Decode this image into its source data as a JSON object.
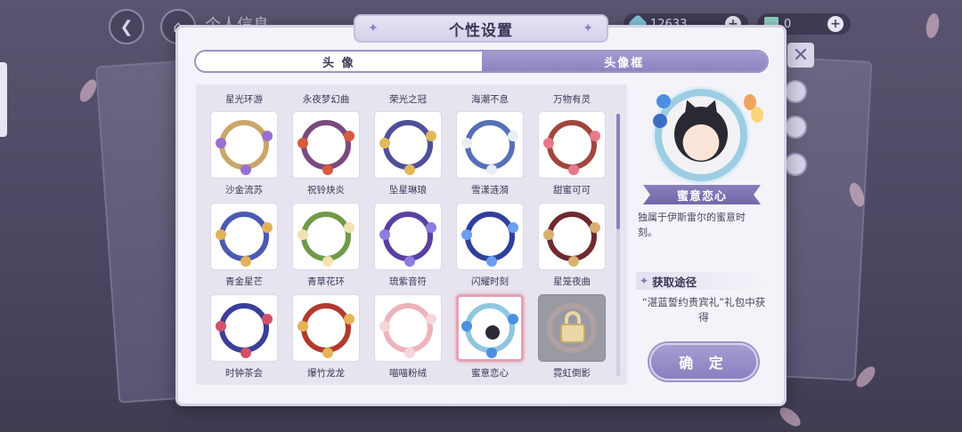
{
  "hud": {
    "title": "个人信息",
    "currency1_value": "12633",
    "currency2_value": "0"
  },
  "panel": {
    "title": "个性设置",
    "tabs": [
      {
        "label": "头 像",
        "active": false
      },
      {
        "label": "头像框",
        "active": true
      }
    ]
  },
  "frames": {
    "top_row_labels": [
      "星光环游",
      "永夜梦幻曲",
      "荣光之冠",
      "海潮不息",
      "万物有灵"
    ],
    "items": [
      {
        "label": "沙金流苏",
        "ring": "#c9a76a",
        "gem": "#9a6fd0",
        "selected": false,
        "locked": false
      },
      {
        "label": "祝铃炔炎",
        "ring": "#7a4a7e",
        "gem": "#d65a3e",
        "selected": false,
        "locked": false
      },
      {
        "label": "坠星琳琅",
        "ring": "#4f4f9a",
        "gem": "#e2b85a",
        "selected": false,
        "locked": false
      },
      {
        "label": "雪漾涟漪",
        "ring": "#5670b8",
        "gem": "#e9eef6",
        "selected": false,
        "locked": false
      },
      {
        "label": "甜蜜可可",
        "ring": "#a0463e",
        "gem": "#e8788c",
        "selected": false,
        "locked": false
      },
      {
        "label": "青金星芒",
        "ring": "#4a5bb0",
        "gem": "#e0b25c",
        "selected": false,
        "locked": false
      },
      {
        "label": "青草花环",
        "ring": "#6f9a4a",
        "gem": "#f2e2b0",
        "selected": false,
        "locked": false
      },
      {
        "label": "琉紫音符",
        "ring": "#5b3fa0",
        "gem": "#8c7ee0",
        "selected": false,
        "locked": false
      },
      {
        "label": "闪耀时刻",
        "ring": "#2f3f9a",
        "gem": "#6a9ef0",
        "selected": false,
        "locked": false
      },
      {
        "label": "星笼夜曲",
        "ring": "#6e2a2e",
        "gem": "#d8b070",
        "selected": false,
        "locked": false
      },
      {
        "label": "时钟茶会",
        "ring": "#3a3f9a",
        "gem": "#d2506a",
        "selected": false,
        "locked": false
      },
      {
        "label": "爆竹龙龙",
        "ring": "#b03a2e",
        "gem": "#e6b35a",
        "selected": false,
        "locked": false
      },
      {
        "label": "喵喵粉绒",
        "ring": "#eeb3bc",
        "gem": "#f6d6dc",
        "selected": false,
        "locked": false
      },
      {
        "label": "蜜意恋心",
        "ring": "#8fc6e0",
        "gem": "#4c8fe0",
        "selected": true,
        "locked": false
      },
      {
        "label": "霓虹倒影",
        "ring": "#bfa7a0",
        "gem": "#e9d7a8",
        "selected": false,
        "locked": true
      }
    ]
  },
  "preview": {
    "name": "蜜意恋心",
    "description": "独属于伊斯雷尔的蜜意时刻。",
    "obtain_heading": "获取途径",
    "obtain_text": "“湛蓝誓约贵宾礼”礼包中获得",
    "confirm_label": "确 定"
  }
}
